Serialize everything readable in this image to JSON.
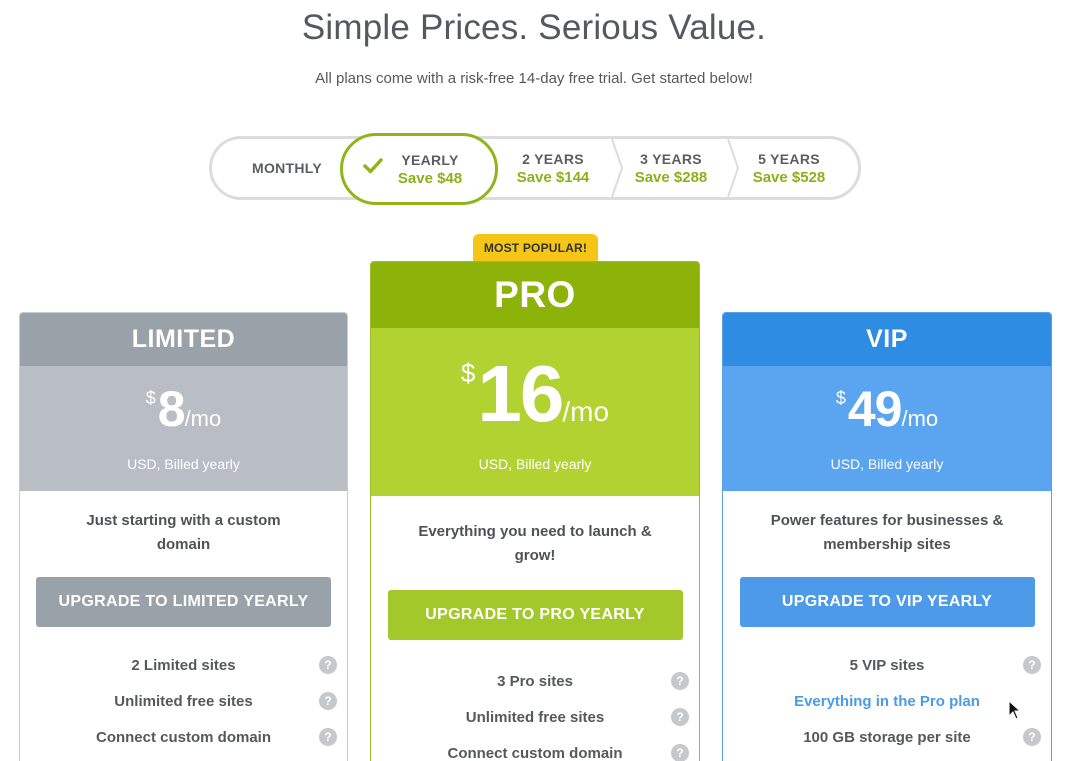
{
  "header": {
    "title": "Simple Prices. Serious Value.",
    "subtitle": "All plans come with a risk-free 14-day free trial. Get started below!"
  },
  "billing_toggle": {
    "monthly": "MONTHLY",
    "options": [
      {
        "label": "YEARLY",
        "save": "Save $48",
        "selected": true
      },
      {
        "label": "2 YEARS",
        "save": "Save $144"
      },
      {
        "label": "3 YEARS",
        "save": "Save $288"
      },
      {
        "label": "5 YEARS",
        "save": "Save $528"
      }
    ]
  },
  "badge": "MOST POPULAR!",
  "plans": [
    {
      "name": "LIMITED",
      "currency": "$",
      "price": "8",
      "period": "/mo",
      "billed": "USD, Billed yearly",
      "tagline": "Just starting with a custom domain",
      "cta": "UPGRADE TO LIMITED YEARLY",
      "features": [
        "2 Limited sites",
        "Unlimited free sites",
        "Connect custom domain"
      ]
    },
    {
      "name": "PRO",
      "currency": "$",
      "price": "16",
      "period": "/mo",
      "billed": "USD, Billed yearly",
      "tagline": "Everything you need to launch & grow!",
      "cta": "UPGRADE TO PRO YEARLY",
      "features": [
        "3 Pro sites",
        "Unlimited free sites",
        "Connect custom domain"
      ]
    },
    {
      "name": "VIP",
      "currency": "$",
      "price": "49",
      "period": "/mo",
      "billed": "USD, Billed yearly",
      "tagline": "Power features for businesses & membership sites",
      "cta": "UPGRADE TO VIP YEARLY",
      "features": [
        "5 VIP sites",
        "Everything in the Pro plan",
        "100 GB storage per site"
      ]
    }
  ],
  "help_glyph": "?",
  "colors": {
    "accent_green": "#8db20a",
    "limited_gray": "#9aa2a9",
    "vip_blue": "#2f8ce3",
    "badge_yellow": "#f5c518"
  }
}
